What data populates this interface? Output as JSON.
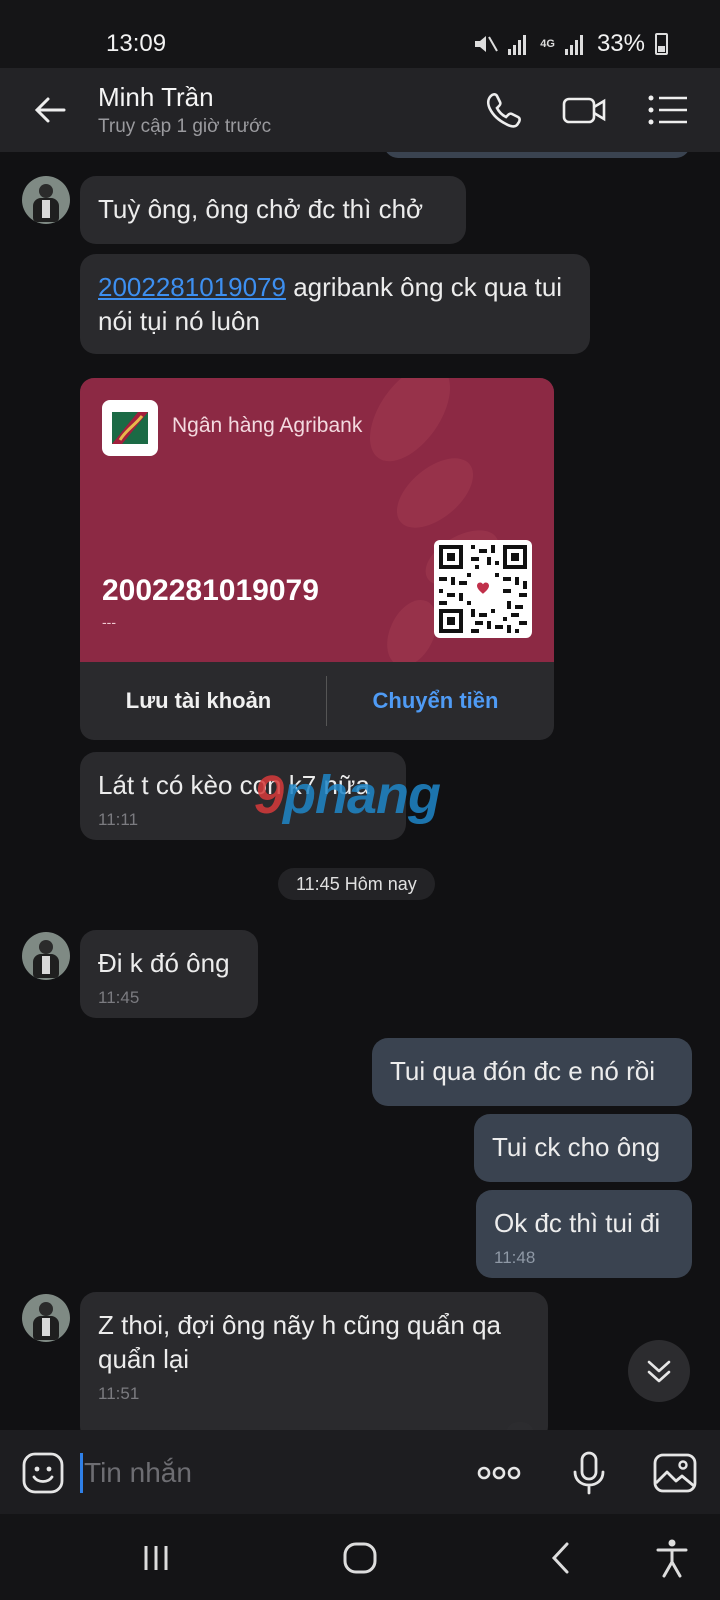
{
  "status_bar": {
    "time": "13:09",
    "network": "4G",
    "battery": "33%"
  },
  "header": {
    "name": "Minh Trần",
    "subtitle": "Truy cập 1 giờ trước"
  },
  "messages": {
    "m1": {
      "text": "Tuỳ ông, ông chở đc thì chở"
    },
    "m2": {
      "link": "2002281019079",
      "text": " agribank ông ck qua tui nói tụi nó luôn"
    },
    "card": {
      "bank_name": "Ngân hàng Agribank",
      "account_number": "2002281019079",
      "holder": "---",
      "save_label": "Lưu tài khoản",
      "transfer_label": "Chuyển tiền"
    },
    "m3": {
      "text": "Lát t có kèo con k7 nữa",
      "time": "11:11"
    },
    "date_chip": "11:45 Hôm nay",
    "m4": {
      "text": "Đi k đó ông",
      "time": "11:45"
    },
    "m5": {
      "text": "Tui qua đón đc e nó rồi"
    },
    "m6": {
      "text": "Tui ck cho ông"
    },
    "m7": {
      "text": "Ok đc thì tui đi",
      "time": "11:48"
    },
    "m8": {
      "text": "Z thoi, đợi ông nãy h cũng quẩn qa quẩn lại",
      "time": "11:51"
    }
  },
  "watermark": {
    "part1": "9",
    "part2": "phang"
  },
  "input": {
    "placeholder": "Tin nhắn"
  },
  "colors": {
    "accent": "#3d8ff0",
    "card_bg": "#8c2944",
    "my_bubble": "#3a4350",
    "their_bubble": "#2a2a2d"
  }
}
